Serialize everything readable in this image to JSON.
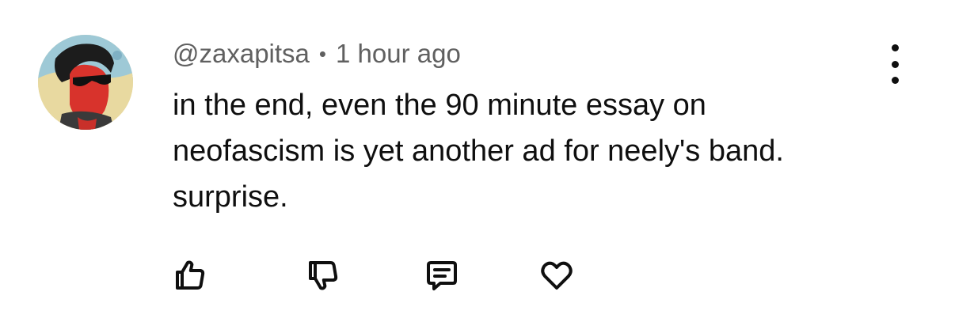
{
  "comment": {
    "author": "@zaxapitsa",
    "separator": "•",
    "time": "1 hour ago",
    "text_lines": [
      "in the end, even the 90 minute essay on",
      "neofascism is yet another ad for neely's band.",
      "surprise."
    ]
  },
  "actions": {
    "like_icon": "thumbs-up-icon",
    "dislike_icon": "thumbs-down-icon",
    "reply_icon": "comment-bubble-icon",
    "heart_icon": "heart-icon",
    "menu_icon": "more-vertical-icon"
  }
}
